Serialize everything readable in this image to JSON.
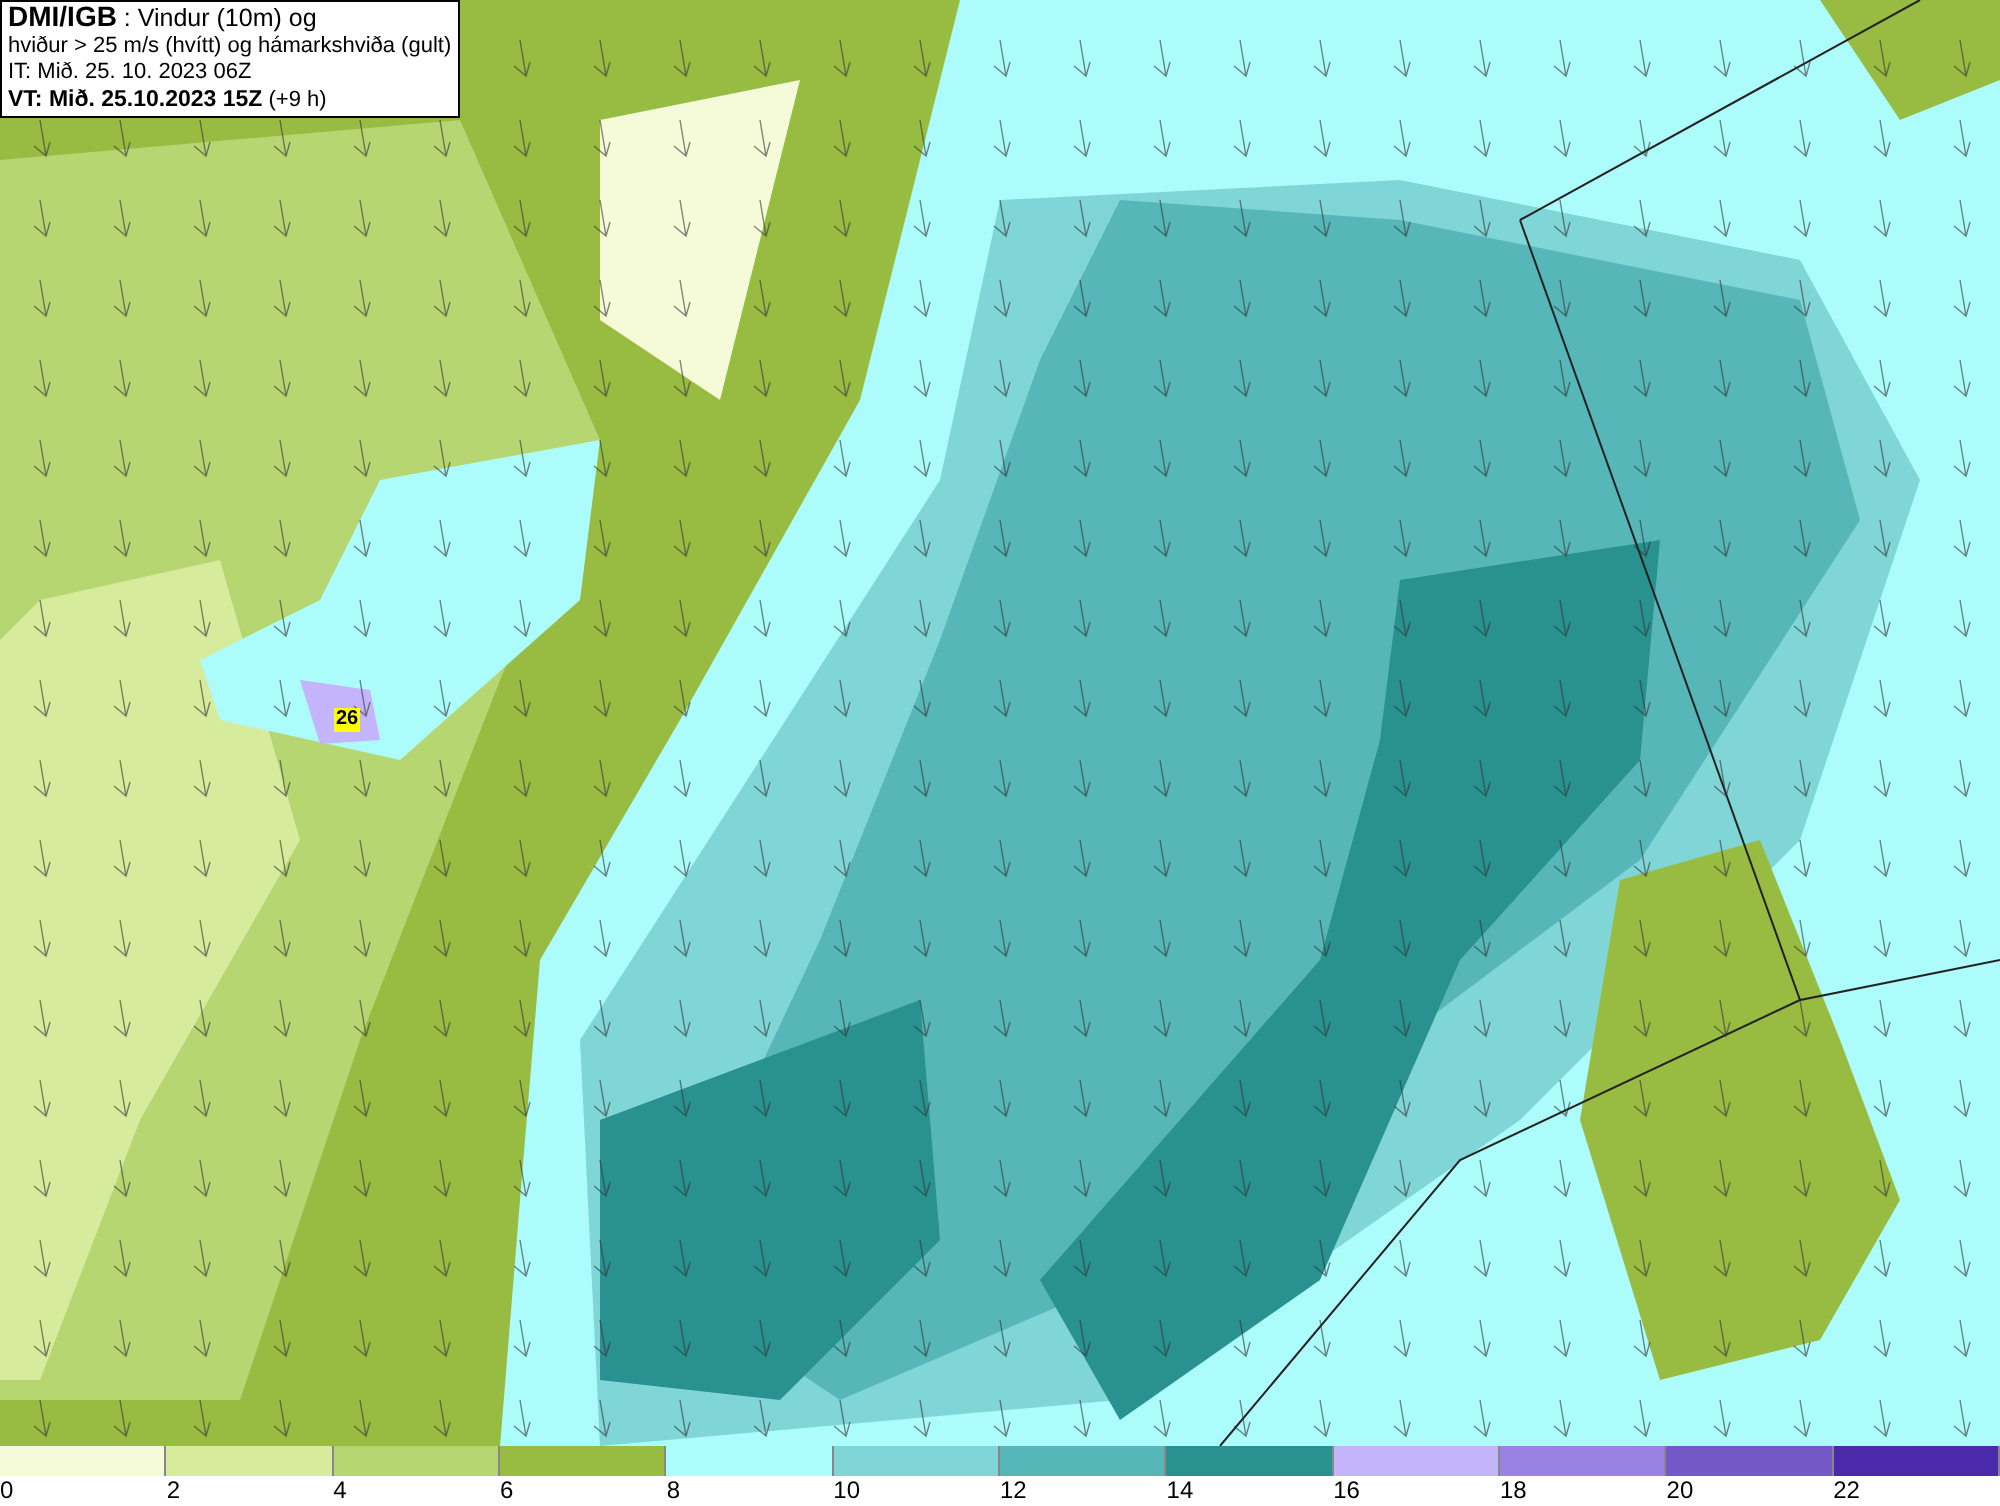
{
  "header": {
    "lines": [
      "**DMI/IGB** : Vindur (10m) og",
      "hviður > 25 m/s (hvítt) og hámarkshviða (gult)",
      "IT: Mið. 25. 10. 2023 06Z",
      "**VT: Mið. 25.10.2023 15Z** (+9 h)"
    ]
  },
  "map": {
    "markers": [
      {
        "label": "26"
      }
    ]
  },
  "legend": [
    {
      "color": "#f5fad8",
      "label": "0"
    },
    {
      "color": "#d6eb9c",
      "label": "2"
    },
    {
      "color": "#b6d672",
      "label": "4"
    },
    {
      "color": "#98bb42",
      "label": "6"
    },
    {
      "color": "#adfcfc",
      "label": "8"
    },
    {
      "color": "#80d6d6",
      "label": "10"
    },
    {
      "color": "#56b6b8",
      "label": "12"
    },
    {
      "color": "#29918f",
      "label": "14"
    },
    {
      "color": "#c4b4fc",
      "label": "16"
    },
    {
      "color": "#9a82e2",
      "label": "18"
    },
    {
      "color": "#7458c8",
      "label": "20"
    },
    {
      "color": "#4a2aa8",
      "label": "22"
    }
  ]
}
